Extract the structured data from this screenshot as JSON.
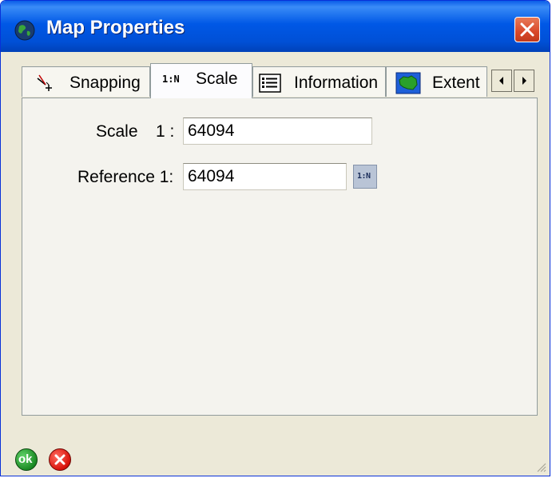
{
  "window": {
    "title": "Map Properties",
    "icons": {
      "app": "globe-icon",
      "close": "close-icon"
    },
    "colors": {
      "titlebar": "#0058e6",
      "close": "#d9492a",
      "face": "#ece9d8"
    }
  },
  "tabs": [
    {
      "label": "Snapping",
      "icon": "snapping-icon",
      "active": false
    },
    {
      "label": "Scale",
      "icon_text": "1:N",
      "active": true
    },
    {
      "label": "Information",
      "icon": "information-list-icon",
      "active": false
    },
    {
      "label": "Extent",
      "icon": "extent-map-icon",
      "active": false
    }
  ],
  "tab_scroll": {
    "left": "scroll-left-icon",
    "right": "scroll-right-icon"
  },
  "scale_tab": {
    "scale_label": "Scale",
    "scale_prefix": "1 :",
    "scale_value": "64094",
    "reference_label": "Reference 1:",
    "reference_value": "64094",
    "ratio_button_text": "1:N"
  },
  "footer": {
    "ok_text": "ok",
    "cancel_icon": "cancel-x-icon",
    "grip_icon": "resize-grip-icon"
  }
}
